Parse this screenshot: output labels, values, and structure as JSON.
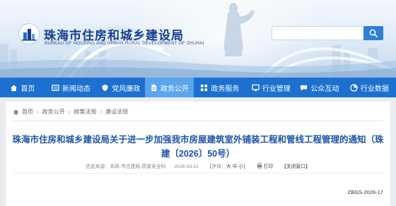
{
  "site": {
    "title": "珠海市住房和城乡建设局",
    "subtitle": "BUREAU OF HOUSING AND URBAN-RURAL DEVELOPMENT OF ZHUHAI"
  },
  "search": {
    "placeholder": "",
    "value": ""
  },
  "nav": [
    {
      "label": "首页",
      "icon": "home-icon"
    },
    {
      "label": "新闻动态",
      "icon": "newspaper-icon"
    },
    {
      "label": "党风廉政",
      "icon": "shield-icon"
    },
    {
      "label": "政务公开",
      "icon": "document-icon",
      "active": true
    },
    {
      "label": "政务服务",
      "icon": "service-icon"
    },
    {
      "label": "行业管理",
      "icon": "monitor-icon"
    },
    {
      "label": "公众互动",
      "icon": "chat-icon"
    },
    {
      "label": "行业数据",
      "icon": "chart-icon"
    }
  ],
  "breadcrumb": [
    "首页",
    "政务公开",
    "政策法规",
    "建设法规"
  ],
  "article": {
    "title": "珠海市住房和城乡建设局关于进一步加强我市房屋建筑室外铺装工程和管线工程管理的通知（珠建〔2026〕50号）",
    "source_label": "信息来源：本网-市住建局-质量安全科",
    "date": "2026-03-31",
    "font_label": "【字体：",
    "font_large": "大",
    "font_medium": "中",
    "font_small": "小",
    "font_close": "】",
    "print_label": "打印",
    "close_label": "【关闭窗口】",
    "doc_id": "ZBGS-2026-17"
  },
  "colors": {
    "nav_bg": "#1c70cf",
    "nav_active": "#5aa5ec",
    "title_blue": "#1d54a8",
    "logo_blue": "#153e8c"
  }
}
